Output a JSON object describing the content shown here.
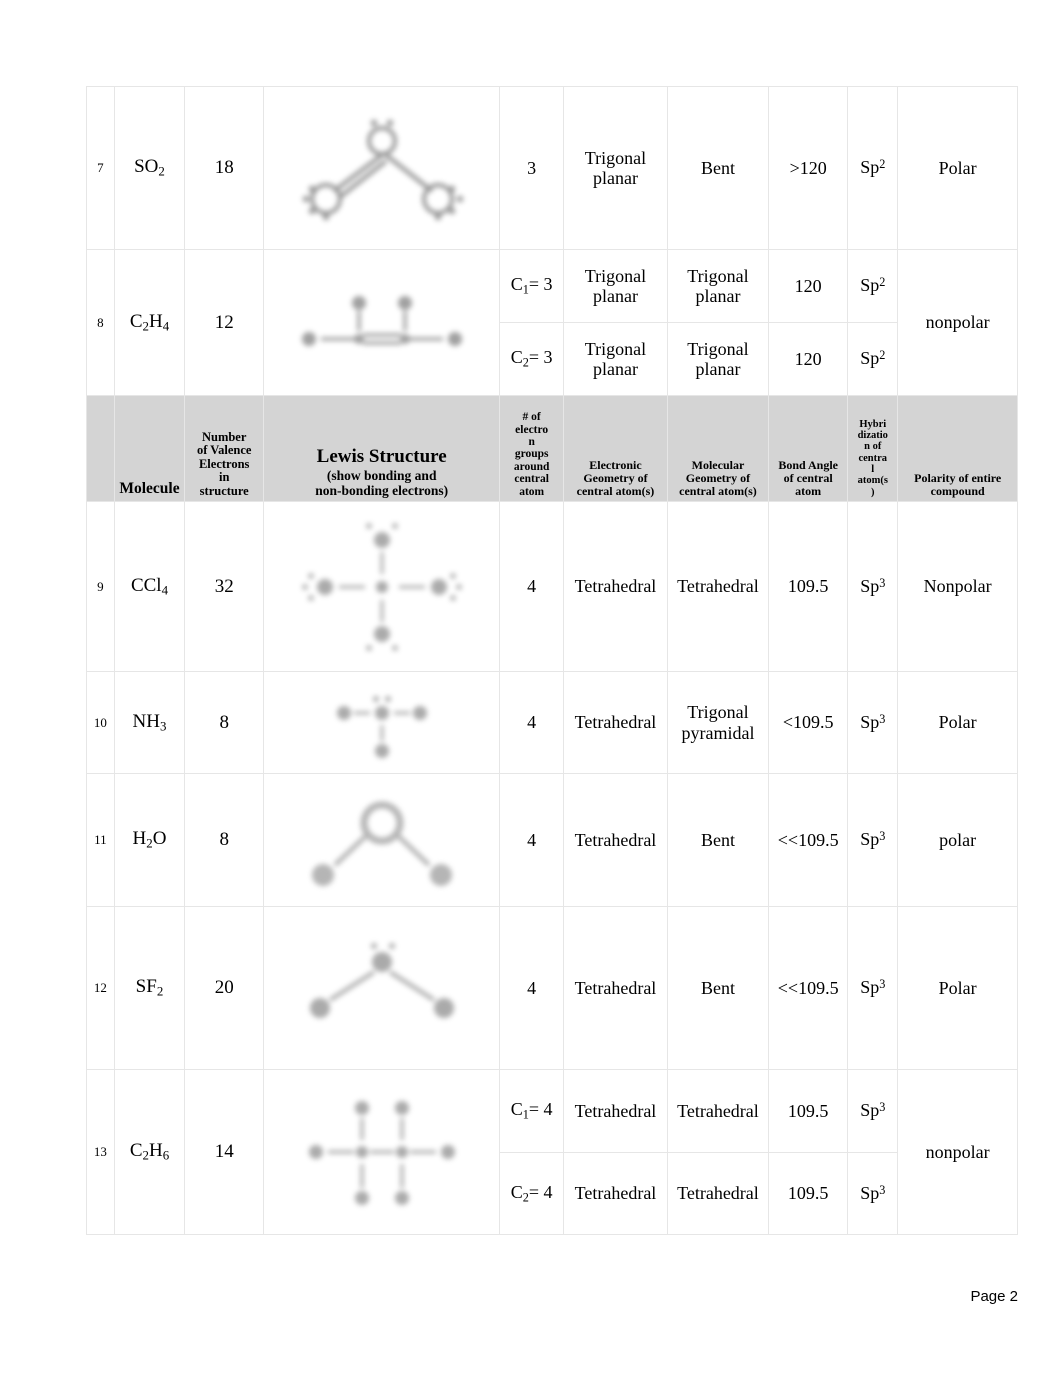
{
  "document": {
    "footer_label": "Page 2"
  },
  "table": {
    "headers": {
      "number": "",
      "molecule": "Molecule",
      "valence": "Number of Valence Electrons in structure",
      "valence_lines": [
        "Number",
        "of Valence",
        "Electrons",
        "in",
        "structure"
      ],
      "lewis_title": "Lewis Structure",
      "lewis_subtitle_lines": [
        "(show bonding and",
        "non-bonding electrons)"
      ],
      "groups_lines": [
        "# of",
        "electro",
        "n",
        "groups",
        "around",
        "central",
        "atom"
      ],
      "electronic_geometry_lines": [
        "Electronic",
        "Geometry of",
        "central atom(s)"
      ],
      "molecular_geometry_lines": [
        "Molecular",
        "Geometry of",
        "central atom(s)"
      ],
      "bond_angle_lines": [
        "Bond Angle",
        "of central",
        "atom"
      ],
      "hybridization_lines": [
        "Hybri",
        "dizatio",
        "n of",
        "centra",
        "l",
        "atom(s",
        ")"
      ],
      "polarity_lines": [
        "Polarity of entire",
        "compound"
      ]
    },
    "rows": [
      {
        "number": "7",
        "molecule_base": "SO",
        "molecule_sub": "2",
        "valence": "18",
        "lewis_icon": "so2-lewis-structure",
        "groups": "3",
        "electronic_geometry": "Trigonal planar",
        "molecular_geometry": "Bent",
        "bond_angle": ">120",
        "hybridization_base": "Sp",
        "hybridization_sup": "2",
        "polarity": "Polar"
      },
      {
        "number": "8",
        "molecule_base": "C",
        "molecule_sub": "2",
        "molecule_base2": "H",
        "molecule_sub2": "4",
        "valence": "12",
        "lewis_icon": "c2h4-lewis-structure",
        "polarity": "nonpolar",
        "sub_rows": [
          {
            "groups_label_base": "C",
            "groups_label_sub": "1",
            "groups_label_tail": "= 3",
            "electronic_geometry": "Trigonal planar",
            "molecular_geometry": "Trigonal planar",
            "bond_angle": "120",
            "hybridization_base": "Sp",
            "hybridization_sup": "2"
          },
          {
            "groups_label_base": "C",
            "groups_label_sub": "2",
            "groups_label_tail": "= 3",
            "electronic_geometry": "Trigonal planar",
            "molecular_geometry": "Trigonal planar",
            "bond_angle": "120",
            "hybridization_base": "Sp",
            "hybridization_sup": "2"
          }
        ]
      },
      {
        "number": "9",
        "molecule_base": "CCl",
        "molecule_sub": "4",
        "valence": "32",
        "lewis_icon": "ccl4-lewis-structure",
        "groups": "4",
        "electronic_geometry": "Tetrahedral",
        "molecular_geometry": "Tetrahedral",
        "bond_angle": "109.5",
        "hybridization_base": "Sp",
        "hybridization_sup": "3",
        "polarity": "Nonpolar"
      },
      {
        "number": "10",
        "molecule_base": "NH",
        "molecule_sub": "3",
        "valence": "8",
        "lewis_icon": "nh3-lewis-structure",
        "groups": "4",
        "electronic_geometry": "Tetrahedral",
        "molecular_geometry": "Trigonal pyramidal",
        "bond_angle": "<109.5",
        "hybridization_base": "Sp",
        "hybridization_sup": "3",
        "polarity": "Polar"
      },
      {
        "number": "11",
        "molecule_base": "H",
        "molecule_sub": "2",
        "molecule_base2": "O",
        "valence": "8",
        "lewis_icon": "h2o-lewis-structure",
        "groups": "4",
        "electronic_geometry": "Tetrahedral",
        "molecular_geometry": "Bent",
        "bond_angle": "<<109.5",
        "hybridization_base": "Sp",
        "hybridization_sup": "3",
        "polarity": "polar"
      },
      {
        "number": "12",
        "molecule_base": "SF",
        "molecule_sub": "2",
        "valence": "20",
        "lewis_icon": "sf2-lewis-structure",
        "groups": "4",
        "electronic_geometry": "Tetrahedral",
        "molecular_geometry": "Bent",
        "bond_angle": "<<109.5",
        "hybridization_base": "Sp",
        "hybridization_sup": "3",
        "polarity": "Polar"
      },
      {
        "number": "13",
        "molecule_base": "C",
        "molecule_sub": "2",
        "molecule_base2": "H",
        "molecule_sub2": "6",
        "valence": "14",
        "lewis_icon": "c2h6-lewis-structure",
        "polarity": "nonpolar",
        "sub_rows": [
          {
            "groups_label_base": "C",
            "groups_label_sub": "1",
            "groups_label_tail": "= 4",
            "electronic_geometry": "Tetrahedral",
            "molecular_geometry": "Tetrahedral",
            "bond_angle": "109.5",
            "hybridization_base": "Sp",
            "hybridization_sup": "3"
          },
          {
            "groups_label_base": "C",
            "groups_label_sub": "2",
            "groups_label_tail": "= 4",
            "electronic_geometry": "Tetrahedral",
            "molecular_geometry": "Tetrahedral",
            "bond_angle": "109.5",
            "hybridization_base": "Sp",
            "hybridization_sup": "3"
          }
        ]
      }
    ]
  },
  "colors": {
    "header_background": "#d4d4d4",
    "border": "#e6e6e6",
    "text": "#000000",
    "page_background": "#ffffff"
  }
}
